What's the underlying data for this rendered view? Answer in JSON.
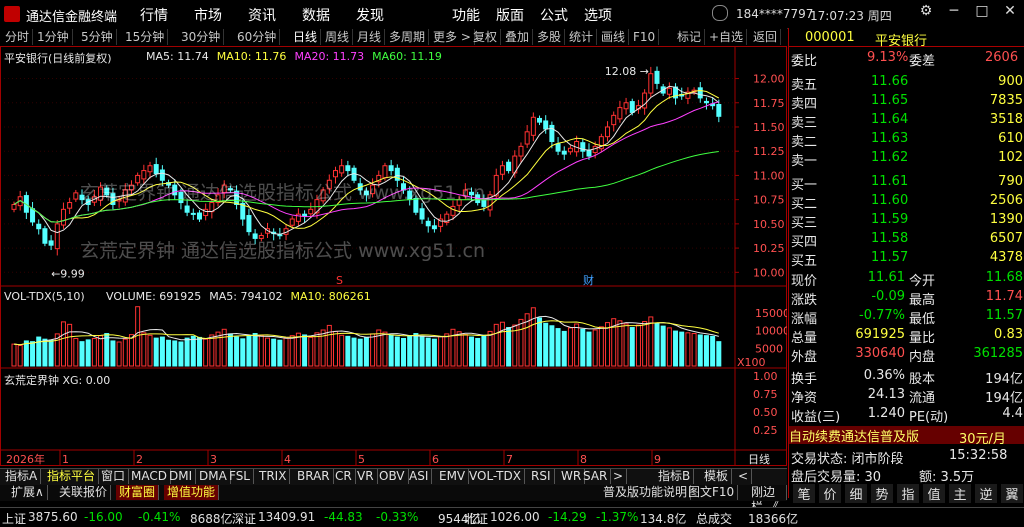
{
  "app": {
    "title": "通达信金融终端",
    "menu": [
      "行情",
      "市场",
      "资讯",
      "数据",
      "发现",
      "功能",
      "版面",
      "公式",
      "选项"
    ],
    "user": "184****7797",
    "time_week": "17:07:23 周四"
  },
  "toolbar": {
    "left": [
      "分时",
      "1分钟",
      "5分钟",
      "15分钟",
      "30分钟",
      "60分钟",
      "日线",
      "周线",
      "月线",
      "多周期",
      "更多 >"
    ],
    "right": [
      "复权",
      "叠加",
      "多股",
      "统计",
      "画线",
      "F10",
      "标记",
      "+自选",
      "返回"
    ],
    "active": "日线"
  },
  "chart": {
    "header": "平安银行(日线前复权)",
    "ma_labels": [
      {
        "text": "MA5: 11.74",
        "color": "#e8e8e8"
      },
      {
        "text": "MA10: 11.76",
        "color": "#ffff40"
      },
      {
        "text": "MA20: 11.73",
        "color": "#ff40ff"
      },
      {
        "text": "MA60: 11.19",
        "color": "#40ff40"
      }
    ],
    "vol_header": "VOL-TDX(5,10)",
    "vol_labels": [
      {
        "text": "VOLUME: 691925",
        "color": "#e8e8e8"
      },
      {
        "text": "MA5: 794102",
        "color": "#e8e8e8"
      },
      {
        "text": "MA10: 806261",
        "color": "#ffff40"
      }
    ],
    "ind_header": "玄荒定界钟",
    "ind_value": "XG: 0.00",
    "annot_high": "12.08",
    "annot_low": "9.99",
    "marker_s": "S",
    "marker_cai": "财",
    "vol_unit": "X100",
    "year_label": "2026年",
    "day_label": "日线"
  },
  "chart_data": {
    "type": "candlestick",
    "y_ticks": [
      10.0,
      10.25,
      10.5,
      10.75,
      11.0,
      11.25,
      11.5,
      11.75,
      12.0
    ],
    "ylim": [
      9.9,
      12.15
    ],
    "vol_ticks": [
      5000,
      10000,
      15000
    ],
    "ind_ticks": [
      0.25,
      0.5,
      0.75,
      1.0
    ],
    "x_months": [
      "1",
      "2",
      "3",
      "4",
      "5",
      "6",
      "7",
      "8",
      "9"
    ],
    "closes": [
      10.7,
      10.78,
      10.62,
      10.52,
      10.45,
      10.3,
      10.28,
      10.5,
      10.65,
      10.72,
      10.82,
      10.75,
      10.7,
      10.78,
      10.88,
      10.8,
      10.7,
      10.75,
      10.85,
      10.9,
      11.0,
      11.05,
      11.1,
      11.02,
      10.95,
      10.9,
      10.8,
      10.72,
      10.62,
      10.6,
      10.55,
      10.65,
      10.72,
      10.8,
      10.9,
      10.85,
      10.7,
      10.55,
      10.42,
      10.35,
      10.38,
      10.45,
      10.4,
      10.38,
      10.45,
      10.55,
      10.6,
      10.58,
      10.65,
      10.75,
      10.85,
      10.95,
      11.05,
      11.1,
      11.05,
      10.95,
      10.85,
      10.8,
      10.9,
      11.0,
      11.1,
      11.05,
      10.95,
      10.85,
      10.75,
      10.62,
      10.55,
      10.48,
      10.45,
      10.55,
      10.6,
      10.68,
      10.75,
      10.85,
      10.8,
      10.72,
      10.68,
      10.8,
      11.0,
      11.1,
      11.05,
      11.2,
      11.3,
      11.45,
      11.6,
      11.55,
      11.48,
      11.35,
      11.25,
      11.22,
      11.28,
      11.35,
      11.25,
      11.2,
      11.3,
      11.4,
      11.5,
      11.62,
      11.7,
      11.75,
      11.65,
      11.72,
      11.85,
      12.05,
      11.95,
      11.85,
      11.9,
      11.8,
      11.82,
      11.86,
      11.88,
      11.8,
      11.75,
      11.72,
      11.61
    ],
    "volumes": [
      6200,
      5800,
      7100,
      6900,
      8200,
      7600,
      7300,
      9100,
      12500,
      11800,
      7800,
      6900,
      7400,
      7800,
      8600,
      9200,
      7100,
      6800,
      7600,
      8900,
      16800,
      9400,
      8700,
      7900,
      8200,
      7300,
      7100,
      6800,
      7900,
      8400,
      8100,
      7600,
      8800,
      9600,
      10400,
      9100,
      8200,
      7700,
      8600,
      9200,
      8500,
      7900,
      7600,
      7300,
      7900,
      8600,
      9300,
      8800,
      8100,
      9400,
      10200,
      11500,
      9800,
      8700,
      8400,
      7900,
      7600,
      8100,
      9100,
      10200,
      9600,
      8800,
      8200,
      7800,
      8600,
      9200,
      8400,
      7900,
      7600,
      8300,
      9100,
      10400,
      9700,
      8900,
      8200,
      7800,
      8700,
      9800,
      11800,
      12400,
      10900,
      11600,
      13200,
      14800,
      16500,
      13600,
      12100,
      11400,
      10600,
      9800,
      10800,
      11900,
      10400,
      9600,
      10200,
      11100,
      12300,
      13400,
      12800,
      11900,
      10900,
      11600,
      12600,
      13900,
      12100,
      11300,
      10800,
      9900,
      9600,
      9400,
      9200,
      8800,
      8600,
      8400,
      6900
    ]
  },
  "panel": {
    "code": "000001",
    "name": "平安银行",
    "weibi_label": "委比",
    "weibi_val": "9.13%",
    "weicha_label": "委差",
    "weicha_val": "2606",
    "sells": [
      {
        "label": "卖五",
        "price": "11.66",
        "vol": "900"
      },
      {
        "label": "卖四",
        "price": "11.65",
        "vol": "7835"
      },
      {
        "label": "卖三",
        "price": "11.64",
        "vol": "3518"
      },
      {
        "label": "卖二",
        "price": "11.63",
        "vol": "610"
      },
      {
        "label": "卖一",
        "price": "11.62",
        "vol": "102"
      }
    ],
    "buys": [
      {
        "label": "买一",
        "price": "11.61",
        "vol": "790"
      },
      {
        "label": "买二",
        "price": "11.60",
        "vol": "2506"
      },
      {
        "label": "买三",
        "price": "11.59",
        "vol": "1390"
      },
      {
        "label": "买四",
        "price": "11.58",
        "vol": "6507"
      },
      {
        "label": "买五",
        "price": "11.57",
        "vol": "4378"
      }
    ],
    "stats": [
      {
        "l1": "现价",
        "v1": "11.61",
        "c1": "green",
        "l2": "今开",
        "v2": "11.68",
        "c2": "green"
      },
      {
        "l1": "涨跌",
        "v1": "-0.09",
        "c1": "green",
        "l2": "最高",
        "v2": "11.74",
        "c2": "red"
      },
      {
        "l1": "涨幅",
        "v1": "-0.77%",
        "c1": "green",
        "l2": "最低",
        "v2": "11.57",
        "c2": "green"
      },
      {
        "l1": "总量",
        "v1": "691925",
        "c1": "yellow",
        "l2": "量比",
        "v2": "0.83",
        "c2": "yellow"
      },
      {
        "l1": "外盘",
        "v1": "330640",
        "c1": "red",
        "l2": "内盘",
        "v2": "361285",
        "c2": "green"
      }
    ],
    "stats2": [
      {
        "l1": "换手",
        "v1": "0.36%",
        "l2": "股本",
        "v2": "194亿"
      },
      {
        "l1": "净资",
        "v1": "24.13",
        "l2": "流通",
        "v2": "194亿"
      },
      {
        "l1": "收益(三)",
        "v1": "1.240",
        "l2": "PE(动)",
        "v2": "4.4"
      }
    ],
    "promo": "自动续费通达信普及版",
    "promo_price": "30元/月",
    "trade_state": "交易状态: 闭市阶段",
    "trade_time": "15:32:58",
    "after_volume": "盘后交易量: 30",
    "after_amount": "额: 3.5万",
    "actions": [
      "笔",
      "价",
      "细",
      "势",
      "指",
      "值",
      "主",
      "逆",
      "翼"
    ]
  },
  "tabs": {
    "row1": [
      "指标A",
      "指标平台",
      "窗口",
      "MACD",
      "DMI",
      "DMA",
      "FSL",
      "TRIX",
      "BRAR",
      "CR",
      "VR",
      "OBV",
      "ASI",
      "EMV",
      "VOL-TDX",
      "RSI",
      "WR",
      "SAR",
      ">"
    ],
    "row1_right": [
      "指标B",
      "模板",
      "<"
    ],
    "row2": [
      "扩展∧",
      "关联报价",
      "财富圈",
      "增值功能"
    ],
    "row2_right": [
      "普及版功能说明",
      "图文F10",
      "刚边栏 《"
    ]
  },
  "status": {
    "items": [
      {
        "label": "上证",
        "vals": [
          "3875.60",
          "-16.00",
          "-0.41%",
          "8688亿"
        ]
      },
      {
        "label": "深证",
        "vals": [
          "13409.91",
          "-44.83",
          "-0.33%",
          "9544亿"
        ]
      },
      {
        "label": "北证",
        "vals": [
          "1026.00",
          "-14.29",
          "-1.37%",
          "134.8亿"
        ]
      },
      {
        "label": "总成交",
        "vals": [
          "18366亿"
        ]
      }
    ]
  },
  "watermark": {
    "text1": "玄荒定界钟 通达信选股指标公式 www.xg51.cn",
    "text2": "玄荒定界钟 通达信选股指标公式 www.xg51.cn"
  }
}
